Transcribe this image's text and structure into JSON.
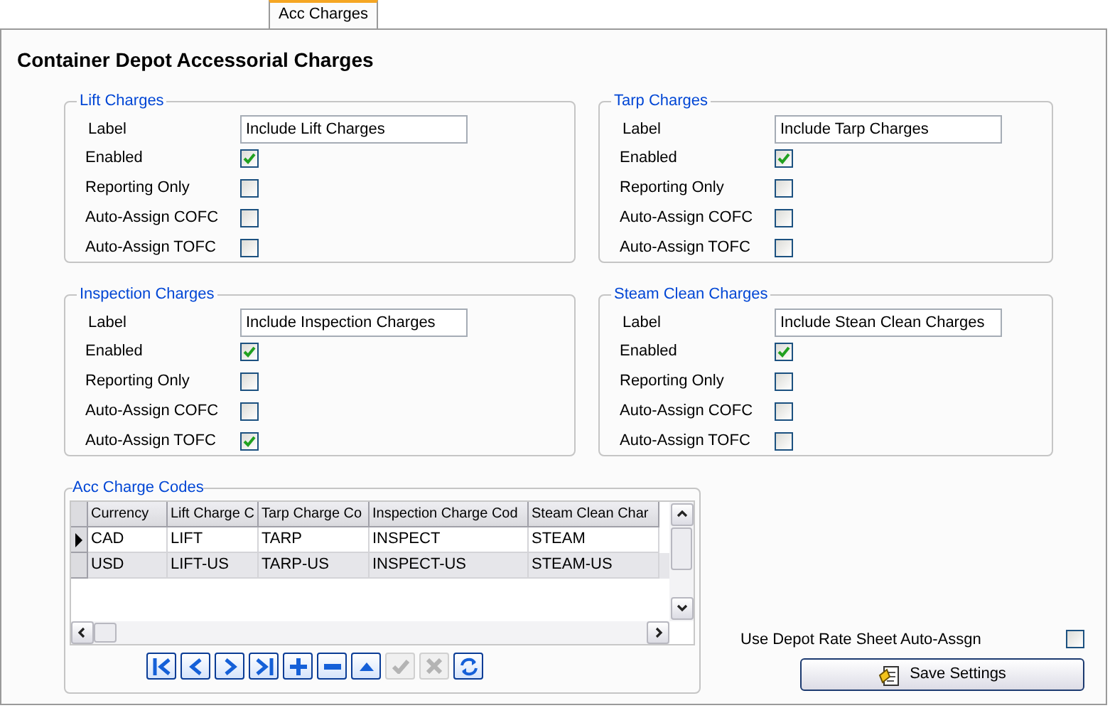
{
  "tabs": [
    {
      "label": "Acc Charges",
      "selected": true
    }
  ],
  "title": "Container Depot Accessorial Charges",
  "groups": [
    {
      "legend": "Lift Charges",
      "label_caption": "Label",
      "label_value": "Include Lift Charges",
      "options": [
        {
          "label": "Enabled",
          "checked": true
        },
        {
          "label": "Reporting Only",
          "checked": false
        },
        {
          "label": "Auto-Assign COFC",
          "checked": false
        },
        {
          "label": "Auto-Assign TOFC",
          "checked": false
        }
      ]
    },
    {
      "legend": "Tarp Charges",
      "label_caption": "Label",
      "label_value": "Include Tarp Charges",
      "options": [
        {
          "label": "Enabled",
          "checked": true
        },
        {
          "label": "Reporting Only",
          "checked": false
        },
        {
          "label": "Auto-Assign COFC",
          "checked": false
        },
        {
          "label": "Auto-Assign TOFC",
          "checked": false
        }
      ]
    },
    {
      "legend": "Inspection Charges",
      "label_caption": "Label",
      "label_value": "Include Inspection Charges",
      "options": [
        {
          "label": "Enabled",
          "checked": true
        },
        {
          "label": "Reporting Only",
          "checked": false
        },
        {
          "label": "Auto-Assign COFC",
          "checked": false
        },
        {
          "label": "Auto-Assign TOFC",
          "checked": true
        }
      ]
    },
    {
      "legend": "Steam Clean Charges",
      "label_caption": "Label",
      "label_value": "Include Stean Clean Charges",
      "options": [
        {
          "label": "Enabled",
          "checked": true
        },
        {
          "label": "Reporting Only",
          "checked": false
        },
        {
          "label": "Auto-Assign COFC",
          "checked": false
        },
        {
          "label": "Auto-Assign TOFC",
          "checked": false
        }
      ]
    }
  ],
  "codes": {
    "legend": "Acc Charge Codes",
    "columns": [
      "Currency",
      "Lift Charge C",
      "Tarp Charge Co",
      "Inspection Charge Cod",
      "Steam Clean Char"
    ],
    "rows": [
      {
        "selected": true,
        "cells": [
          "CAD",
          "LIFT",
          "TARP",
          "INSPECT",
          "STEAM"
        ]
      },
      {
        "selected": false,
        "cells": [
          "USD",
          "LIFT-US",
          "TARP-US",
          "INSPECT-US",
          "STEAM-US"
        ]
      }
    ],
    "navigator": [
      {
        "kind": "first",
        "disabled": false
      },
      {
        "kind": "prev",
        "disabled": false
      },
      {
        "kind": "next",
        "disabled": false
      },
      {
        "kind": "last",
        "disabled": false
      },
      {
        "kind": "add",
        "disabled": false
      },
      {
        "kind": "remove",
        "disabled": false
      },
      {
        "kind": "up",
        "disabled": false
      },
      {
        "kind": "confirm",
        "disabled": true
      },
      {
        "kind": "cancel",
        "disabled": true
      },
      {
        "kind": "refresh",
        "disabled": false
      }
    ]
  },
  "auto_assign": {
    "label": "Use Depot Rate Sheet Auto-Assgn",
    "checked": false
  },
  "save_button": "Save Settings"
}
